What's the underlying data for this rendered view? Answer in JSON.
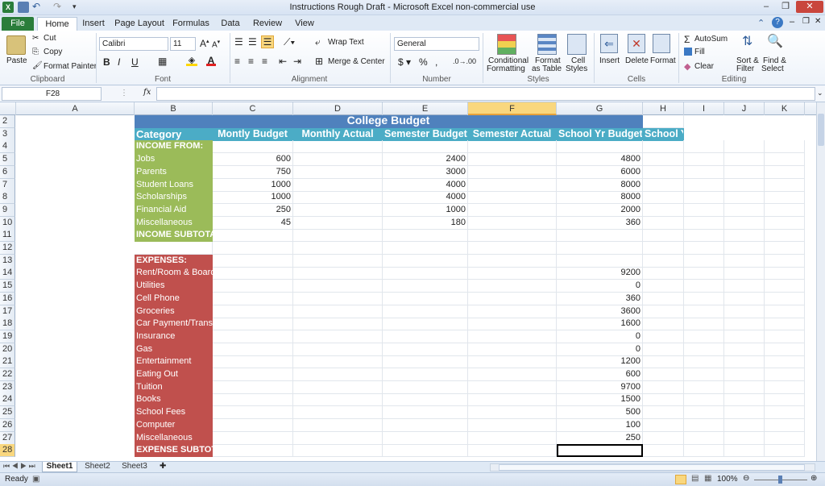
{
  "window": {
    "title": "Instructions Rough Draft  -  Microsoft Excel non-commercial use"
  },
  "tabs": [
    "File",
    "Home",
    "Insert",
    "Page Layout",
    "Formulas",
    "Data",
    "Review",
    "View"
  ],
  "ribbon": {
    "clipboard": {
      "paste": "Paste",
      "cut": "Cut",
      "copy": "Copy",
      "format_painter": "Format Painter",
      "label": "Clipboard"
    },
    "font": {
      "name": "Calibri",
      "size": "11",
      "label": "Font"
    },
    "alignment": {
      "wrap": "Wrap Text",
      "merge": "Merge & Center",
      "label": "Alignment"
    },
    "number": {
      "format": "General",
      "label": "Number"
    },
    "styles": {
      "conditional": "Conditional",
      "conditional2": "Formatting",
      "format_table": "Format",
      "format_table2": "as Table",
      "cell_styles": "Cell",
      "cell_styles2": "Styles",
      "label": "Styles"
    },
    "cells": {
      "insert": "Insert",
      "delete": "Delete",
      "format": "Format",
      "label": "Cells"
    },
    "editing": {
      "autosum": "AutoSum",
      "fill": "Fill",
      "clear": "Clear",
      "sort": "Sort &",
      "sort2": "Filter",
      "find": "Find &",
      "find2": "Select",
      "label": "Editing"
    }
  },
  "formula_bar": {
    "name_box": "F28",
    "fx": "fx",
    "value": ""
  },
  "columns": [
    "A",
    "B",
    "C",
    "D",
    "E",
    "F",
    "G",
    "H",
    "I",
    "J",
    "K"
  ],
  "selected_column": "F",
  "selected_row": "28",
  "sheet": {
    "title": "College Budget",
    "headers": [
      "Category",
      "Montly Budget",
      "Monthly Actual",
      "Semester Budget",
      "Semester Actual",
      "School Yr Budget",
      "School YR Actual"
    ],
    "rows": [
      {
        "r": "4",
        "a": "INCOME FROM:",
        "b": "",
        "d": "",
        "f": "",
        "type": "income",
        "bold": true
      },
      {
        "r": "5",
        "a": "Jobs",
        "b": "600",
        "d": "2400",
        "f": "4800",
        "type": "income"
      },
      {
        "r": "6",
        "a": "Parents",
        "b": "750",
        "d": "3000",
        "f": "6000",
        "type": "income"
      },
      {
        "r": "7",
        "a": "Student Loans",
        "b": "1000",
        "d": "4000",
        "f": "8000",
        "type": "income"
      },
      {
        "r": "8",
        "a": "Scholarships",
        "b": "1000",
        "d": "4000",
        "f": "8000",
        "type": "income"
      },
      {
        "r": "9",
        "a": "Financial Aid",
        "b": "250",
        "d": "1000",
        "f": "2000",
        "type": "income"
      },
      {
        "r": "10",
        "a": "Miscellaneous",
        "b": "45",
        "d": "180",
        "f": "360",
        "type": "income"
      },
      {
        "r": "11",
        "a": "INCOME SUBTOTAL",
        "b": "",
        "d": "",
        "f": "",
        "type": "income",
        "bold": true
      },
      {
        "r": "12",
        "a": "",
        "b": "",
        "d": "",
        "f": "",
        "type": "blank"
      },
      {
        "r": "13",
        "a": "EXPENSES:",
        "b": "",
        "d": "",
        "f": "",
        "type": "expense",
        "bold": true
      },
      {
        "r": "14",
        "a": "Rent/Room & Board",
        "b": "",
        "d": "",
        "f": "9200",
        "type": "expense"
      },
      {
        "r": "15",
        "a": "Utilities",
        "b": "",
        "d": "",
        "f": "0",
        "type": "expense"
      },
      {
        "r": "16",
        "a": "Cell Phone",
        "b": "",
        "d": "",
        "f": "360",
        "type": "expense"
      },
      {
        "r": "17",
        "a": "Groceries",
        "b": "",
        "d": "",
        "f": "3600",
        "type": "expense"
      },
      {
        "r": "18",
        "a": "Car Payment/Transportation",
        "b": "",
        "d": "",
        "f": "1600",
        "type": "expense"
      },
      {
        "r": "19",
        "a": "Insurance",
        "b": "",
        "d": "",
        "f": "0",
        "type": "expense"
      },
      {
        "r": "20",
        "a": "Gas",
        "b": "",
        "d": "",
        "f": "0",
        "type": "expense"
      },
      {
        "r": "21",
        "a": "Entertainment",
        "b": "",
        "d": "",
        "f": "1200",
        "type": "expense"
      },
      {
        "r": "22",
        "a": "Eating Out",
        "b": "",
        "d": "",
        "f": "600",
        "type": "expense"
      },
      {
        "r": "23",
        "a": "Tuition",
        "b": "",
        "d": "",
        "f": "9700",
        "type": "expense"
      },
      {
        "r": "24",
        "a": "Books",
        "b": "",
        "d": "",
        "f": "1500",
        "type": "expense"
      },
      {
        "r": "25",
        "a": "School Fees",
        "b": "",
        "d": "",
        "f": "500",
        "type": "expense"
      },
      {
        "r": "26",
        "a": "Computer",
        "b": "",
        "d": "",
        "f": "100",
        "type": "expense"
      },
      {
        "r": "27",
        "a": "Miscellaneous",
        "b": "",
        "d": "",
        "f": "250",
        "type": "expense"
      },
      {
        "r": "28",
        "a": "EXPENSE SUBTOTAL",
        "b": "",
        "d": "",
        "f": "",
        "type": "expense",
        "bold": true
      }
    ]
  },
  "sheets": [
    "Sheet1",
    "Sheet2",
    "Sheet3"
  ],
  "status": {
    "ready": "Ready",
    "zoom": "100%"
  },
  "colors": {
    "title_bg": "#4f81bd",
    "header_bg": "#4bacc6",
    "income_bg": "#9bbb59",
    "expense_bg": "#c0504d",
    "file_tab": "#2a7d3b"
  }
}
